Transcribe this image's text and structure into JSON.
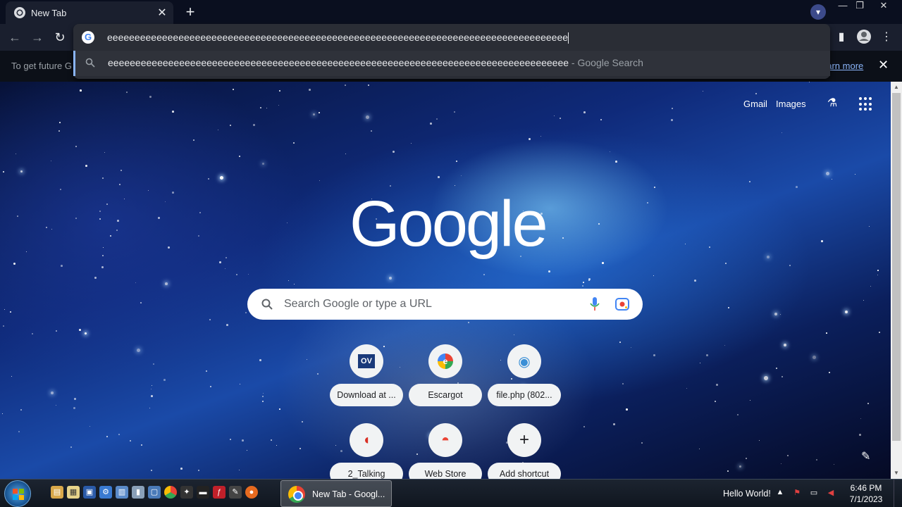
{
  "browser": {
    "tab": {
      "title": "New Tab",
      "close": "✕"
    },
    "new_tab": "+",
    "window_controls": {
      "minimize": "—",
      "restore": "❐",
      "close": "✕"
    },
    "nav": {
      "back": "←",
      "forward": "→",
      "reload": "↻"
    },
    "omnibox": {
      "value": "eeeeeeeeeeeeeeeeeeeeeeeeeeeeeeeeeeeeeeeeeeeeeeeeeeeeeeeeeeeeeeeeeeeeeeeeeeeeeeeeeeee",
      "suggestion_query": "eeeeeeeeeeeeeeeeeeeeeeeeeeeeeeeeeeeeeeeeeeeeeeeeeeeeeeeeeeeeeeeeeeeeeeeeeeeeeeeeeeee",
      "suggestion_suffix": " - Google Search"
    },
    "toolbar_right": {
      "side_panel": "▮",
      "menu": "⋮"
    }
  },
  "infobar": {
    "message": "To get future G",
    "learn_more": "earn more",
    "close": "✕"
  },
  "ntp": {
    "links": {
      "gmail": "Gmail",
      "images": "Images"
    },
    "logo": "Google",
    "search_placeholder": "Search Google or type a URL",
    "shortcuts": [
      {
        "label": "Download at ...",
        "icon_text": "OV",
        "icon": "download-at-favicon"
      },
      {
        "label": "Escargot",
        "icon_text": "e",
        "icon": "escargot-favicon"
      },
      {
        "label": "file.php (802...",
        "icon_text": "◉",
        "icon": "file-php-favicon"
      },
      {
        "label": "2_Talking",
        "icon_text": "◖",
        "icon": "talking-favicon"
      },
      {
        "label": "Web Store",
        "icon_text": "◓",
        "icon": "web-store-icon"
      },
      {
        "label": "Add shortcut",
        "icon_text": "+",
        "icon": "add-icon"
      }
    ],
    "customize_icon": "✎"
  },
  "taskbar": {
    "active_task": "New Tab - Googl...",
    "tray_text": "Hello World!",
    "clock_time": "6:46 PM",
    "clock_date": "7/1/2023"
  },
  "colors": {
    "accent": "#8ab4f8",
    "toolbar": "#1a1f2e",
    "omnibox": "#2a2d35"
  }
}
